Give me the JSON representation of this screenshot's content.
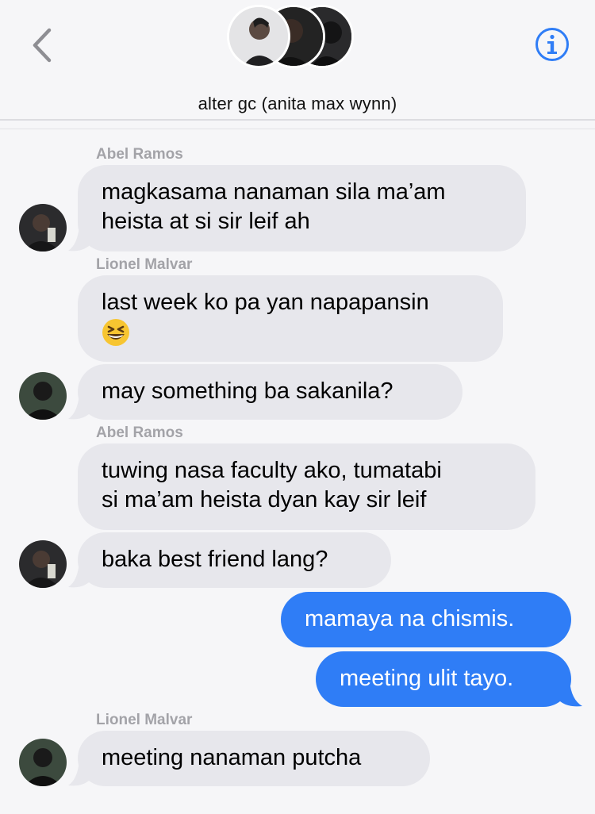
{
  "header": {
    "title": "alter gc (anita max wynn)",
    "back_icon": "chevron-left-icon",
    "info_icon": "info-icon",
    "accent_color": "#2f7df6"
  },
  "messages": [
    {
      "sender": "Abel Ramos",
      "lines": [
        "magkasama nanaman sila ma’am",
        "heista at si sir leif ah"
      ],
      "direction": "incoming"
    },
    {
      "sender": "Lionel Malvar",
      "lines": [
        "last week ko pa yan napapansin"
      ],
      "emoji": "grinning-squinting-face",
      "direction": "incoming"
    },
    {
      "lines": [
        "may something ba sakanila?"
      ],
      "direction": "incoming"
    },
    {
      "sender": "Abel Ramos",
      "lines": [
        "tuwing nasa faculty ako, tumatabi",
        "si ma’am heista dyan kay sir leif"
      ],
      "direction": "incoming"
    },
    {
      "lines": [
        "baka best friend lang?"
      ],
      "direction": "incoming"
    },
    {
      "lines": [
        "mamaya na chismis."
      ],
      "direction": "outgoing"
    },
    {
      "lines": [
        "meeting ulit tayo."
      ],
      "direction": "outgoing"
    },
    {
      "sender": "Lionel Malvar",
      "lines": [
        "meeting nanaman putcha"
      ],
      "direction": "incoming"
    }
  ],
  "colors": {
    "incoming_bubble": "#e7e7ec",
    "outgoing_bubble": "#2f7df6",
    "sender_name": "#a3a3a8",
    "background": "#f6f6f8"
  }
}
